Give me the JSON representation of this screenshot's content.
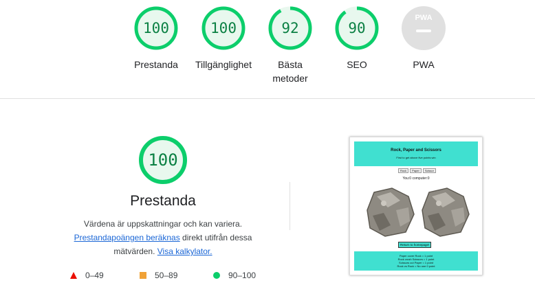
{
  "top_scores": [
    {
      "score": "100",
      "label": "Prestanda"
    },
    {
      "score": "100",
      "label": "Tillgänglighet"
    },
    {
      "score": "92",
      "label": "Bästa metoder"
    },
    {
      "score": "90",
      "label": "SEO"
    },
    {
      "score": "",
      "label": "PWA",
      "badge": "PWA"
    }
  ],
  "main": {
    "score": "100",
    "title": "Prestanda",
    "desc_line1": "Värdena är uppskattningar och kan variera.",
    "desc_link1": "Prestandapoängen beräknas",
    "desc_mid": " direkt utifrån dessa mätvärden.",
    "desc_link2": "Visa kalkylator.",
    "legend": [
      {
        "range": "0–49",
        "color": "#eb0f00"
      },
      {
        "range": "50–89",
        "color": "#f0a237"
      },
      {
        "range": "90–100",
        "color": "#0cce6b"
      }
    ]
  },
  "thumbnail": {
    "title": "Rock, Paper and Scissors",
    "subtitle": "First to get above five points win",
    "buttons": [
      "Rock",
      "Paper",
      "Scissor"
    ],
    "score_text": "You:0 computer:0",
    "return_button": "Return to homepage!",
    "rules": [
      "Paper cover Rock = 1 point",
      "Rock crush Scissors = 1 point",
      "Scissors cut Paper = 1 point",
      "Rock vs Rock = No one 0 point"
    ]
  },
  "colors": {
    "pass": "#0cce6b",
    "pass_text": "#0b8043",
    "pass_bg": "#e8f8ee",
    "gray": "#e0e0e0"
  }
}
